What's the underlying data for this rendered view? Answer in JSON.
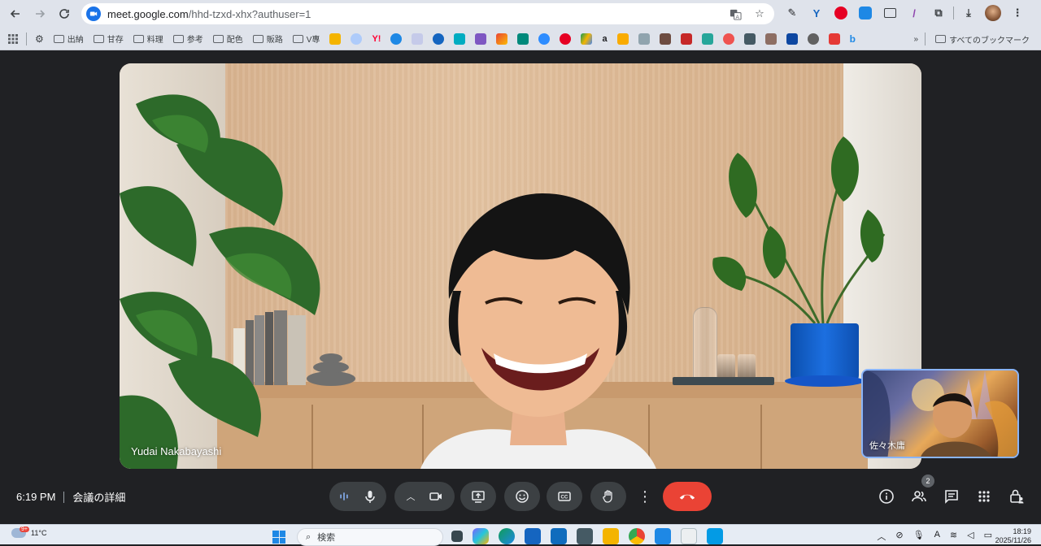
{
  "browser": {
    "url_host": "meet.google.com",
    "url_path": "/hhd-tzxd-xhx?authuser=1"
  },
  "bookmarks": {
    "items": [
      "出納",
      "甘存",
      "料理",
      "参考",
      "配色",
      "販路",
      "V專"
    ],
    "right_label": "すべてのブックマーク"
  },
  "meet": {
    "main_participant": "Yudai Nakabayashi",
    "self_name": "佐々木庸",
    "time": "6:19 PM",
    "meeting_details": "会議の詳細",
    "people_count": "2"
  },
  "taskbar": {
    "temperature": "11°C",
    "weather_badge": "9+",
    "search_placeholder": "検索",
    "time": "18:19",
    "date": "2025/11/26"
  },
  "colors": {
    "meet_bg": "#202124",
    "end_call": "#ea4335",
    "control_bg": "#3c4043",
    "accent": "#1a73e8"
  }
}
